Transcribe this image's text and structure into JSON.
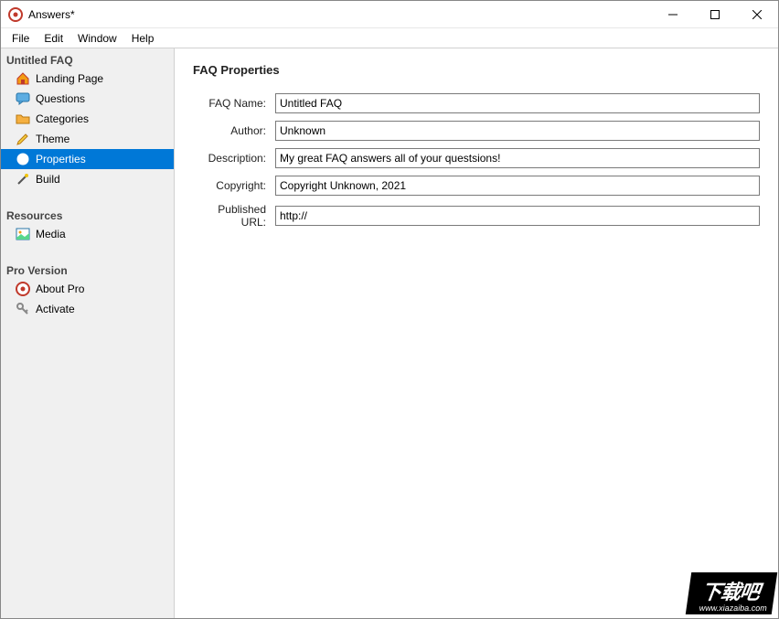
{
  "window": {
    "title": "Answers*"
  },
  "menu": {
    "file": "File",
    "edit": "Edit",
    "window": "Window",
    "help": "Help"
  },
  "sidebar": {
    "section1": {
      "title": "Untitled FAQ",
      "items": [
        {
          "label": "Landing Page"
        },
        {
          "label": "Questions"
        },
        {
          "label": "Categories"
        },
        {
          "label": "Theme"
        },
        {
          "label": "Properties"
        },
        {
          "label": "Build"
        }
      ]
    },
    "section2": {
      "title": "Resources",
      "items": [
        {
          "label": "Media"
        }
      ]
    },
    "section3": {
      "title": "Pro Version",
      "items": [
        {
          "label": "About Pro"
        },
        {
          "label": "Activate"
        }
      ]
    }
  },
  "main": {
    "title": "FAQ Properties",
    "fields": {
      "name_label": "FAQ Name:",
      "name_value": "Untitled FAQ",
      "author_label": "Author:",
      "author_value": "Unknown",
      "desc_label": "Description:",
      "desc_value": "My great FAQ answers all of your questsions!",
      "copy_label": "Copyright:",
      "copy_value": "Copyright Unknown, 2021",
      "url_label": "Published URL:",
      "url_value": "http://"
    }
  },
  "watermark": {
    "big": "下载吧",
    "small": "www.xiazaiba.com"
  }
}
